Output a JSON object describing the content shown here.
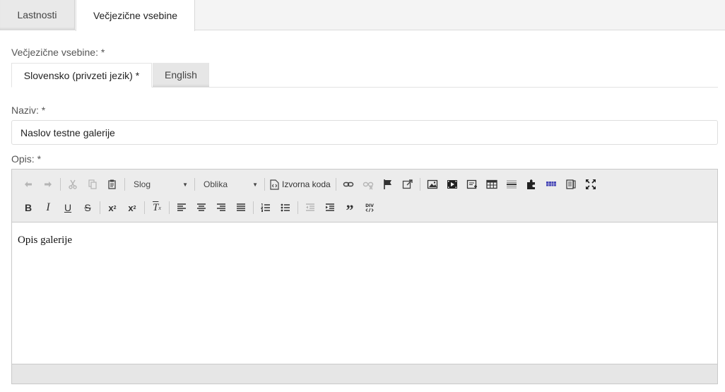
{
  "top_tabs": {
    "properties": "Lastnosti",
    "multilingual": "Večjezične vsebine"
  },
  "multilingual_label": "Večjezične vsebine: *",
  "language_tabs": {
    "primary": "Slovensko (privzeti jezik) *",
    "secondary": "English"
  },
  "name_field": {
    "label": "Naziv: *",
    "value": "Naslov testne galerije"
  },
  "description_field": {
    "label": "Opis: *",
    "content": "Opis galerije"
  },
  "toolbar": {
    "style_combo": "Slog",
    "format_combo": "Oblika",
    "source_button": "Izvorna koda",
    "row1_icons": [
      "undo-icon",
      "redo-icon",
      "cut-icon",
      "copy-icon",
      "paste-icon",
      "link-icon",
      "unlink-icon",
      "anchor-icon",
      "external-link-icon",
      "image-icon",
      "video-icon",
      "iframe-icon",
      "table-icon",
      "horizontal-rule-icon",
      "plugin-icon",
      "grid-icon",
      "template-icon",
      "maximize-icon"
    ],
    "row2_icons": [
      "bold-icon",
      "italic-icon",
      "underline-icon",
      "strikethrough-icon",
      "subscript-icon",
      "superscript-icon",
      "remove-format-icon",
      "align-left-icon",
      "align-center-icon",
      "align-right-icon",
      "align-justify-icon",
      "numbered-list-icon",
      "bulleted-list-icon",
      "outdent-icon",
      "indent-icon",
      "blockquote-icon",
      "div-icon"
    ]
  }
}
